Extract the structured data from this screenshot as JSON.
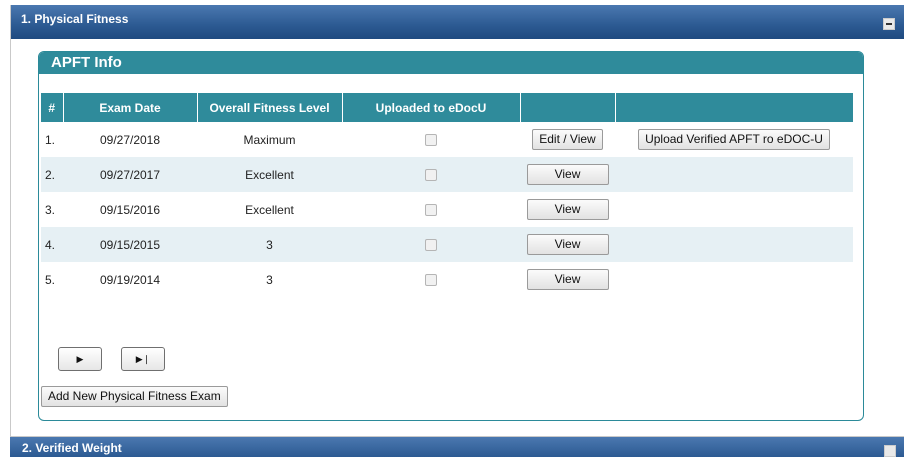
{
  "section1": {
    "title": "1. Physical Fitness",
    "collapse_icon": "minus-box-icon"
  },
  "section2": {
    "title": "2. Verified Weight"
  },
  "panel": {
    "title": "APFT Info",
    "columns": [
      "#",
      "Exam Date",
      "Overall Fitness Level",
      "Uploaded to eDocU",
      "",
      ""
    ],
    "rows": [
      {
        "num": "1.",
        "date": "09/27/2018",
        "level": "Maximum",
        "uploaded": false,
        "action": "Edit / View",
        "upload": "Upload Verified APFT ro eDOC-U"
      },
      {
        "num": "2.",
        "date": "09/27/2017",
        "level": "Excellent",
        "uploaded": false,
        "action": "View",
        "upload": ""
      },
      {
        "num": "3.",
        "date": "09/15/2016",
        "level": "Excellent",
        "uploaded": false,
        "action": "View",
        "upload": ""
      },
      {
        "num": "4.",
        "date": "09/15/2015",
        "level": "3",
        "uploaded": false,
        "action": "View",
        "upload": ""
      },
      {
        "num": "5.",
        "date": "09/19/2014",
        "level": "3",
        "uploaded": false,
        "action": "View",
        "upload": ""
      }
    ],
    "pager": {
      "next_icon": "play-icon",
      "last_icon": "skip-forward-icon"
    },
    "add_button": "Add New Physical Fitness Exam"
  }
}
